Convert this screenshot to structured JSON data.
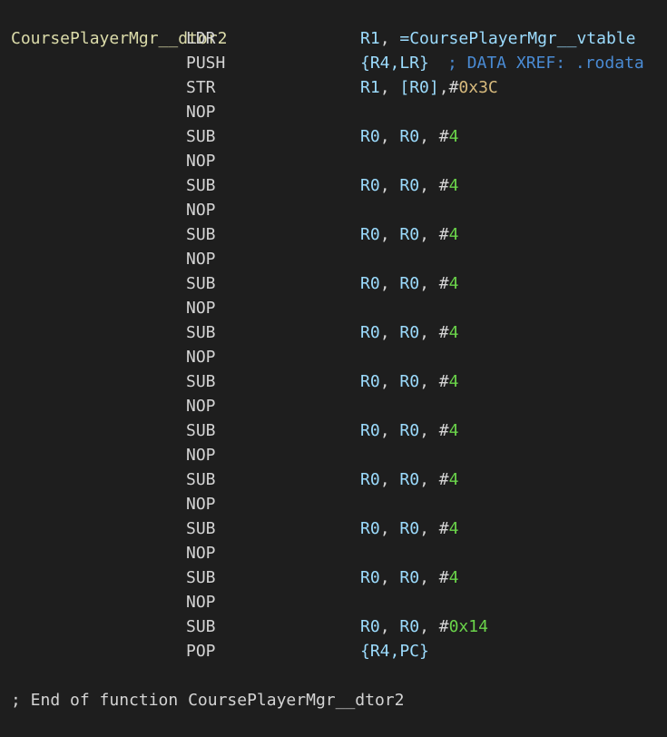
{
  "function": {
    "label": "CoursePlayerMgr__dtor2",
    "xref_comment": "; DATA XREF: .rodata",
    "end_comment": "; End of function CoursePlayerMgr__dtor2"
  },
  "instructions": [
    {
      "mnemonic": "LDR",
      "operands": [
        {
          "t": "reg",
          "v": "R1"
        },
        {
          "t": "punct",
          "v": ", "
        },
        {
          "t": "sym",
          "v": "=CoursePlayerMgr__vtable"
        }
      ]
    },
    {
      "mnemonic": "PUSH",
      "operands": [
        {
          "t": "reg",
          "v": "{R4,LR}"
        }
      ]
    },
    {
      "mnemonic": "STR",
      "operands": [
        {
          "t": "reg",
          "v": "R1"
        },
        {
          "t": "punct",
          "v": ", "
        },
        {
          "t": "reg",
          "v": "[R0]"
        },
        {
          "t": "punct",
          "v": ",#"
        },
        {
          "t": "hex",
          "v": "0x3C"
        }
      ]
    },
    {
      "mnemonic": "NOP",
      "operands": []
    },
    {
      "mnemonic": "SUB",
      "operands": [
        {
          "t": "reg",
          "v": "R0"
        },
        {
          "t": "punct",
          "v": ", "
        },
        {
          "t": "reg",
          "v": "R0"
        },
        {
          "t": "punct",
          "v": ", #"
        },
        {
          "t": "decg",
          "v": "4"
        }
      ]
    },
    {
      "mnemonic": "NOP",
      "operands": []
    },
    {
      "mnemonic": "SUB",
      "operands": [
        {
          "t": "reg",
          "v": "R0"
        },
        {
          "t": "punct",
          "v": ", "
        },
        {
          "t": "reg",
          "v": "R0"
        },
        {
          "t": "punct",
          "v": ", #"
        },
        {
          "t": "decg",
          "v": "4"
        }
      ]
    },
    {
      "mnemonic": "NOP",
      "operands": []
    },
    {
      "mnemonic": "SUB",
      "operands": [
        {
          "t": "reg",
          "v": "R0"
        },
        {
          "t": "punct",
          "v": ", "
        },
        {
          "t": "reg",
          "v": "R0"
        },
        {
          "t": "punct",
          "v": ", #"
        },
        {
          "t": "decg",
          "v": "4"
        }
      ]
    },
    {
      "mnemonic": "NOP",
      "operands": []
    },
    {
      "mnemonic": "SUB",
      "operands": [
        {
          "t": "reg",
          "v": "R0"
        },
        {
          "t": "punct",
          "v": ", "
        },
        {
          "t": "reg",
          "v": "R0"
        },
        {
          "t": "punct",
          "v": ", #"
        },
        {
          "t": "decg",
          "v": "4"
        }
      ]
    },
    {
      "mnemonic": "NOP",
      "operands": []
    },
    {
      "mnemonic": "SUB",
      "operands": [
        {
          "t": "reg",
          "v": "R0"
        },
        {
          "t": "punct",
          "v": ", "
        },
        {
          "t": "reg",
          "v": "R0"
        },
        {
          "t": "punct",
          "v": ", #"
        },
        {
          "t": "decg",
          "v": "4"
        }
      ]
    },
    {
      "mnemonic": "NOP",
      "operands": []
    },
    {
      "mnemonic": "SUB",
      "operands": [
        {
          "t": "reg",
          "v": "R0"
        },
        {
          "t": "punct",
          "v": ", "
        },
        {
          "t": "reg",
          "v": "R0"
        },
        {
          "t": "punct",
          "v": ", #"
        },
        {
          "t": "decg",
          "v": "4"
        }
      ]
    },
    {
      "mnemonic": "NOP",
      "operands": []
    },
    {
      "mnemonic": "SUB",
      "operands": [
        {
          "t": "reg",
          "v": "R0"
        },
        {
          "t": "punct",
          "v": ", "
        },
        {
          "t": "reg",
          "v": "R0"
        },
        {
          "t": "punct",
          "v": ", #"
        },
        {
          "t": "decg",
          "v": "4"
        }
      ]
    },
    {
      "mnemonic": "NOP",
      "operands": []
    },
    {
      "mnemonic": "SUB",
      "operands": [
        {
          "t": "reg",
          "v": "R0"
        },
        {
          "t": "punct",
          "v": ", "
        },
        {
          "t": "reg",
          "v": "R0"
        },
        {
          "t": "punct",
          "v": ", #"
        },
        {
          "t": "decg",
          "v": "4"
        }
      ]
    },
    {
      "mnemonic": "NOP",
      "operands": []
    },
    {
      "mnemonic": "SUB",
      "operands": [
        {
          "t": "reg",
          "v": "R0"
        },
        {
          "t": "punct",
          "v": ", "
        },
        {
          "t": "reg",
          "v": "R0"
        },
        {
          "t": "punct",
          "v": ", #"
        },
        {
          "t": "decg",
          "v": "4"
        }
      ]
    },
    {
      "mnemonic": "NOP",
      "operands": []
    },
    {
      "mnemonic": "SUB",
      "operands": [
        {
          "t": "reg",
          "v": "R0"
        },
        {
          "t": "punct",
          "v": ", "
        },
        {
          "t": "reg",
          "v": "R0"
        },
        {
          "t": "punct",
          "v": ", #"
        },
        {
          "t": "decg",
          "v": "4"
        }
      ]
    },
    {
      "mnemonic": "NOP",
      "operands": []
    },
    {
      "mnemonic": "SUB",
      "operands": [
        {
          "t": "reg",
          "v": "R0"
        },
        {
          "t": "punct",
          "v": ", "
        },
        {
          "t": "reg",
          "v": "R0"
        },
        {
          "t": "punct",
          "v": ", #"
        },
        {
          "t": "hexg",
          "v": "0x14"
        }
      ]
    },
    {
      "mnemonic": "POP",
      "operands": [
        {
          "t": "reg",
          "v": "{R4,PC}"
        }
      ]
    }
  ],
  "colors": {
    "background": "#1e1e1e",
    "label": "#dcdcaa",
    "comment": "#4a8bd4",
    "register": "#9cdcfe",
    "immediate": "#6ad44a",
    "hex_immediate": "#d7ba7d",
    "text": "#d4d4d4"
  }
}
